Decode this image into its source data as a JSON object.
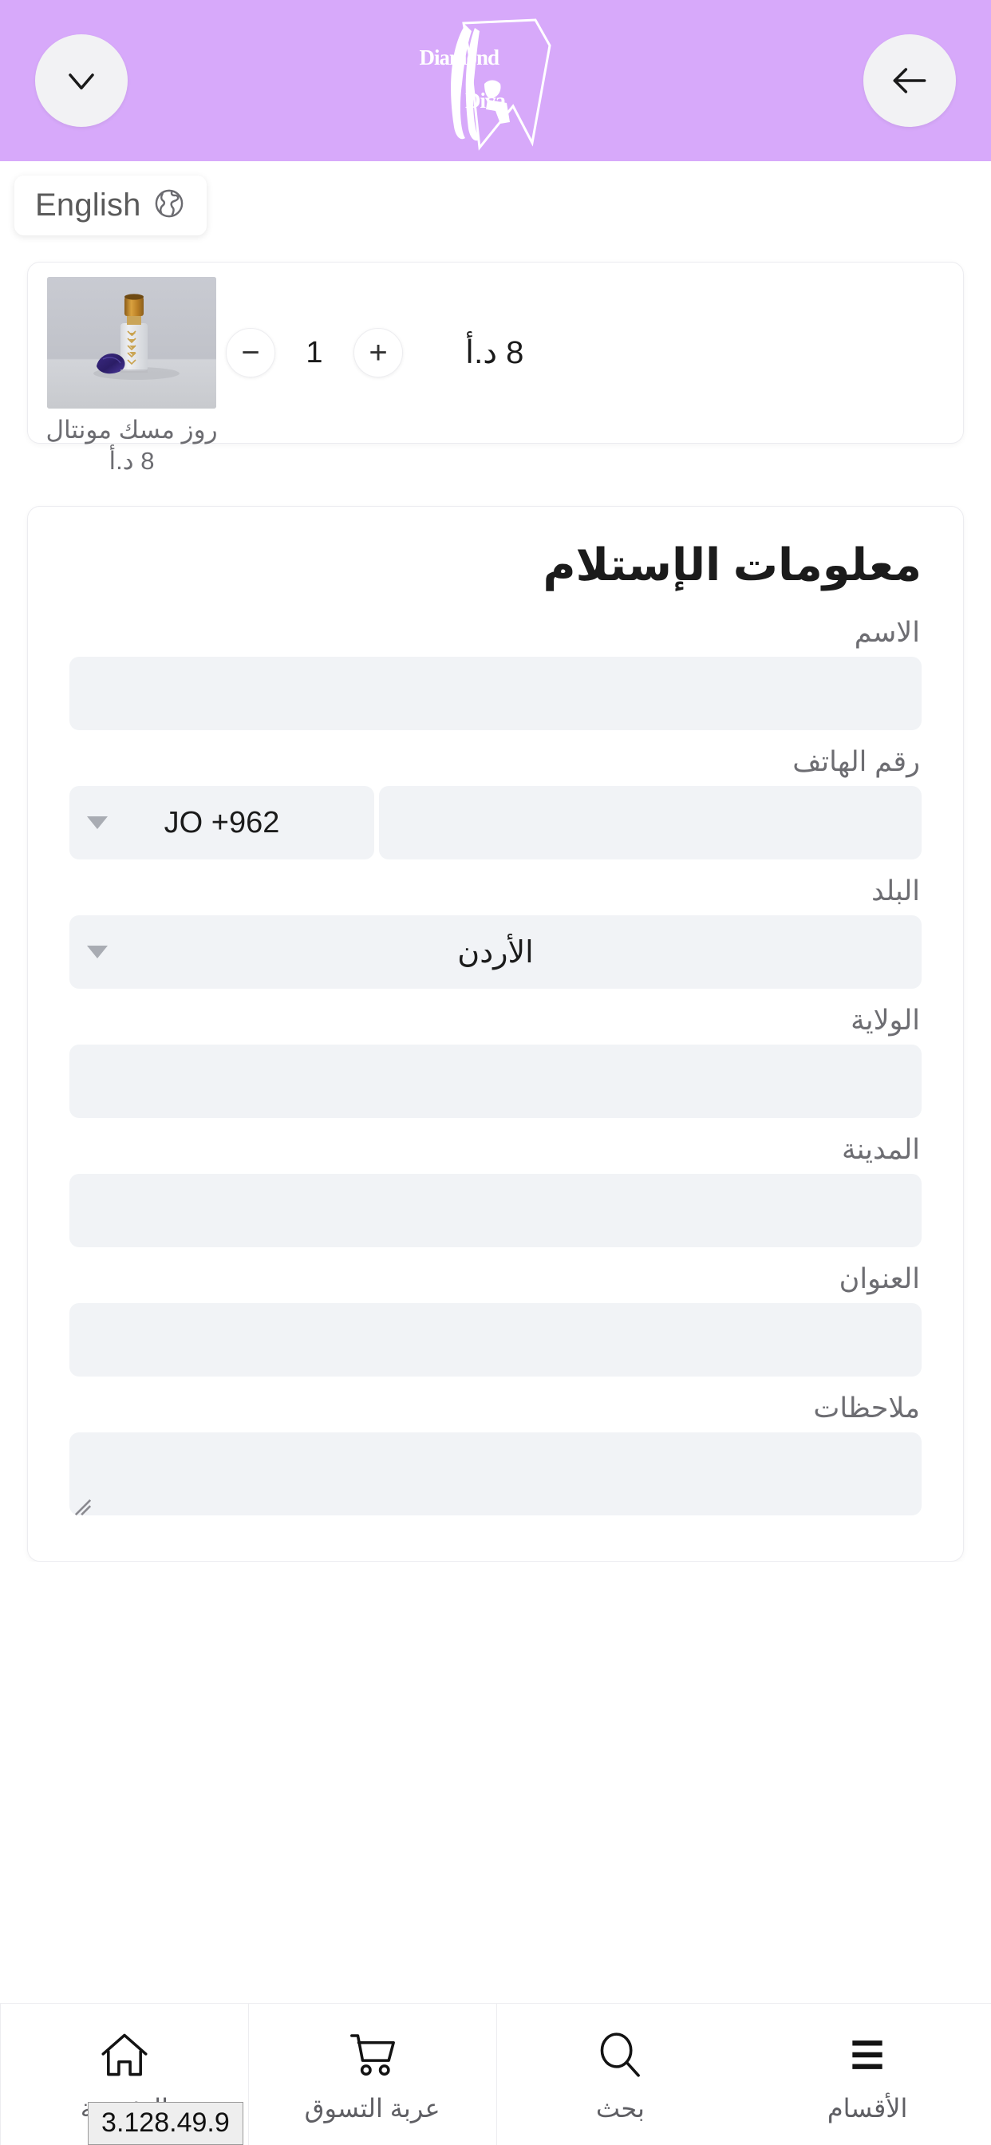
{
  "header": {
    "back_button_label": "رجوع",
    "back_icon": "arrow-left-icon",
    "menu_icon": "chevron-down-icon",
    "logo_line1": "Diamond",
    "logo_line2": "Diva",
    "background_color": "#d7a9fa"
  },
  "language": {
    "label": "English",
    "icon": "globe-icon"
  },
  "cart": {
    "items": [
      {
        "title": "روز مسك مونتال",
        "unit_price": "8 د.أ",
        "line_total": "8 د.أ",
        "quantity": "1",
        "decrease_label": "−",
        "increase_label": "+",
        "image_alt": "زجاجة عطر زيتية بغطاء ذهبي"
      }
    ]
  },
  "form": {
    "title": "معلومات الإستلام",
    "fields": [
      {
        "label": "الاسم",
        "value": "",
        "placeholder": "",
        "type": "text"
      },
      {
        "label": "رقم الهاتف",
        "value": "",
        "placeholder": "",
        "type": "phone",
        "country_code": "JO +962"
      },
      {
        "label": "البلد",
        "value": "الأردن",
        "placeholder": "",
        "type": "select"
      },
      {
        "label": "الولاية",
        "value": "",
        "placeholder": "",
        "type": "text"
      },
      {
        "label": "المدينة",
        "value": "",
        "placeholder": "",
        "type": "text"
      },
      {
        "label": "العنوان",
        "value": "",
        "placeholder": "",
        "type": "text"
      },
      {
        "label": "ملاحظات",
        "value": "",
        "placeholder": "",
        "type": "textarea"
      }
    ]
  },
  "bottom_nav": {
    "items": [
      {
        "label": "الرئيسية",
        "icon": "home-icon"
      },
      {
        "label": "عربة التسوق",
        "icon": "shopping-cart-icon"
      },
      {
        "label": "بحث",
        "icon": "search-icon"
      },
      {
        "label": "الأقسام",
        "icon": "hamburger-menu-icon"
      }
    ],
    "ip_badge": "3.128.49.9"
  },
  "colors": {
    "brand_purple": "#d7a9fa",
    "input_bg": "#f1f3f6",
    "label_gray": "#6d6d72"
  }
}
